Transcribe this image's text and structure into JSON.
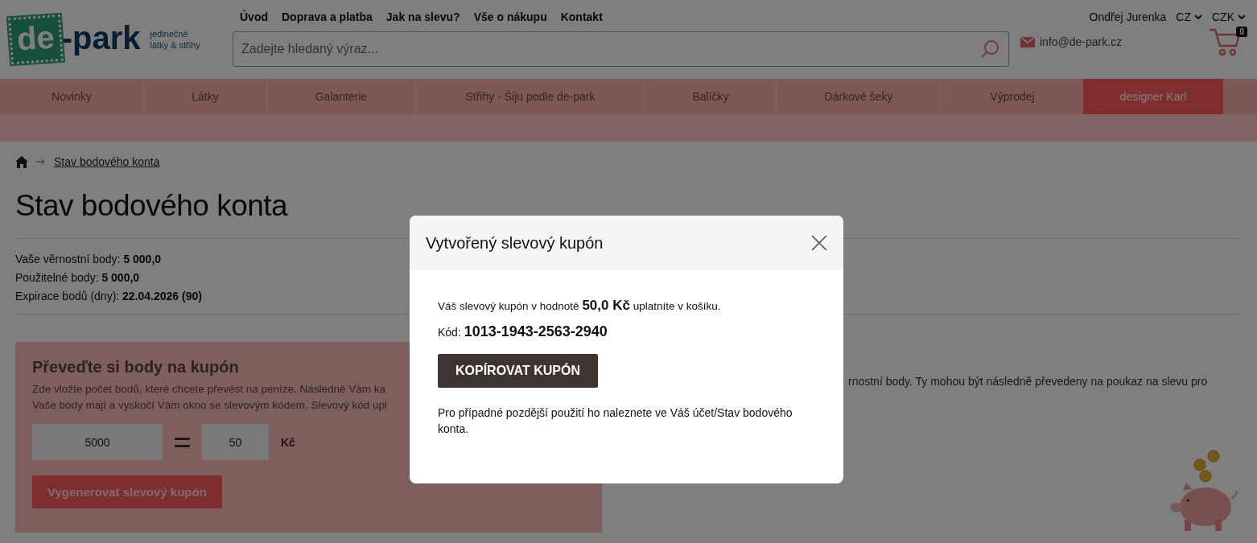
{
  "header": {
    "logo": {
      "mark": "de",
      "name": "-park",
      "tagline_1": "jedinečné",
      "tagline_2": "látky & střihy"
    },
    "top_links": [
      "Úvod",
      "Doprava a platba",
      "Jak na slevu?",
      "Vše o nákupu",
      "Kontakt"
    ],
    "search": {
      "placeholder": "Zadejte hledaný výraz..."
    },
    "user": "Ondřej Jurenka",
    "language": "CZ",
    "currency": "CZK",
    "email": "info@de-park.cz",
    "cart_count": "0"
  },
  "menu": [
    {
      "label": "Novinky",
      "selected": false
    },
    {
      "label": "Látky",
      "selected": false
    },
    {
      "label": "Galanterie",
      "selected": false
    },
    {
      "label": "Střihy - Šiju podle de-park",
      "selected": false
    },
    {
      "label": "Balíčky",
      "selected": false
    },
    {
      "label": "Dárkové šeky",
      "selected": false
    },
    {
      "label": "Výprodej",
      "selected": false
    },
    {
      "label": "designer Karl",
      "selected": true
    }
  ],
  "breadcrumb": [
    "Stav bodového konta"
  ],
  "title": "Stav bodového konta",
  "points": [
    "Vaše věrnostní body: **5 000,0**",
    "Použitelné body: **5 000,0**",
    "Expirace bodů (dny): **22.04.2026 (90)**"
  ],
  "convert": {
    "heading": "Převeďte si body na kupón",
    "text_1": "Zde vložte počet bodů, které chcete převést na peníze. Následně Vám ka",
    "text_2": "Vaše body mají a vyskočí Vám okno se slevovým kódem. Slevový kód upl",
    "points_value": "5000",
    "money_value": "50",
    "currency": "Kč",
    "button": "Vygenerovat slevový kupón"
  },
  "info_text": "rnostní body. Ty mohou být následně převedeny na poukaz na slevu pro",
  "modal": {
    "title": "Vytvořený slevový kupón",
    "value_line": "Váš slevový kupón v hodnotě **50,0 Kč** uplatníte v košíku.",
    "code_line": "Kód: **1013-1943-2563-2940**",
    "button": "KOPÍROVAT KUPÓN",
    "note": "Pro případné pozdější použití ho naleznete ve Váš účet/Stav bodového konta."
  }
}
